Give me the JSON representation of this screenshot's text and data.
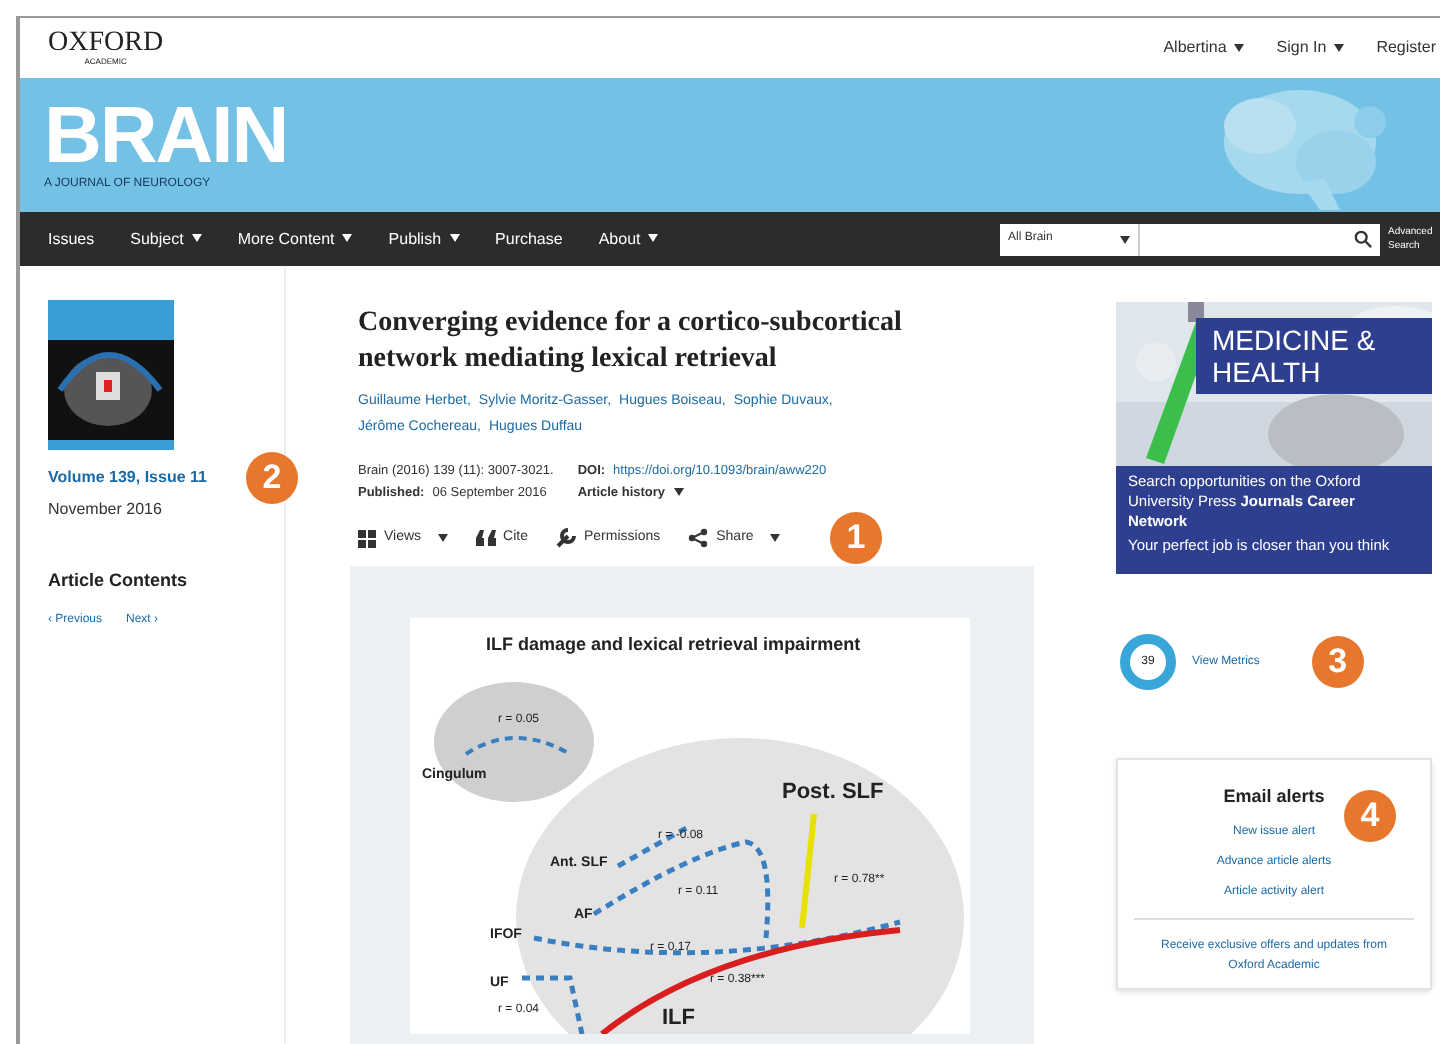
{
  "header": {
    "logo": "OXFORD",
    "logo_sub": "ACADEMIC",
    "user_links": [
      {
        "label": "Albertina",
        "caret": true
      },
      {
        "label": "Sign In",
        "caret": true
      },
      {
        "label": "Register",
        "caret": false
      }
    ]
  },
  "banner": {
    "title": "BRAIN",
    "subtitle": "A JOURNAL OF NEUROLOGY"
  },
  "nav": {
    "items": [
      {
        "label": "Issues",
        "caret": false
      },
      {
        "label": "Subject",
        "caret": true
      },
      {
        "label": "More Content",
        "caret": true
      },
      {
        "label": "Publish",
        "caret": true
      },
      {
        "label": "Purchase",
        "caret": false
      },
      {
        "label": "About",
        "caret": true
      }
    ],
    "scope": "All Brain",
    "advanced": "Advanced Search"
  },
  "sidebar": {
    "issue": "Volume 139, Issue 11",
    "date": "November 2016",
    "contents_title": "Article Contents",
    "prev": "‹ Previous",
    "next": "Next ›"
  },
  "article": {
    "title": "Converging evidence for a cortico-subcortical network mediating lexical retrieval",
    "authors": [
      "Guillaume Herbet,",
      "Sylvie Moritz-Gasser,",
      "Hugues Boiseau,",
      "Sophie Duvaux,",
      "Jérôme Cochereau,",
      "Hugues Duffau"
    ],
    "citation": "Brain (2016) 139 (11): 3007-3021.",
    "doi_label": "DOI:",
    "doi": "https://doi.org/10.1093/brain/aww220",
    "published_label": "Published:",
    "published": "06 September 2016",
    "history": "Article history",
    "tools": [
      {
        "label": "Views",
        "kind": "grid",
        "caret": true
      },
      {
        "label": "Cite",
        "kind": "quote",
        "caret": false
      },
      {
        "label": "Permissions",
        "kind": "wrench",
        "caret": false
      },
      {
        "label": "Share",
        "kind": "share",
        "caret": true
      }
    ]
  },
  "figure": {
    "title": "ILF damage and lexical retrieval impairment",
    "labels": [
      {
        "text": "r = 0.05",
        "kind": "stat"
      },
      {
        "text": "Cingulum",
        "kind": "tract"
      },
      {
        "text": "Post. SLF",
        "kind": "big"
      },
      {
        "text": "r = -0.08",
        "kind": "stat"
      },
      {
        "text": "Ant. SLF",
        "kind": "tract"
      },
      {
        "text": "r = 0.11",
        "kind": "stat"
      },
      {
        "text": "r = 0.78**",
        "kind": "stat"
      },
      {
        "text": "AF",
        "kind": "tract"
      },
      {
        "text": "IFOF",
        "kind": "tract"
      },
      {
        "text": "r = 0.17",
        "kind": "stat"
      },
      {
        "text": "UF",
        "kind": "tract"
      },
      {
        "text": "r = 0.04",
        "kind": "stat"
      },
      {
        "text": "r = 0.38***",
        "kind": "stat"
      },
      {
        "text": "ILF",
        "kind": "big"
      }
    ]
  },
  "ad": {
    "heading": "MEDICINE & HEALTH",
    "body": "Search opportunities on the Oxford University Press **Journals Career Network**",
    "tagline": "Your perfect job is closer than you think"
  },
  "metrics": {
    "count": "39",
    "label": "View Metrics"
  },
  "alerts": {
    "title": "Email alerts",
    "links": [
      "New issue alert",
      "Advance article alerts",
      "Article activity alert"
    ],
    "promo": "Receive exclusive offers and updates from Oxford Academic"
  },
  "callouts": [
    "1",
    "2",
    "3",
    "4"
  ]
}
